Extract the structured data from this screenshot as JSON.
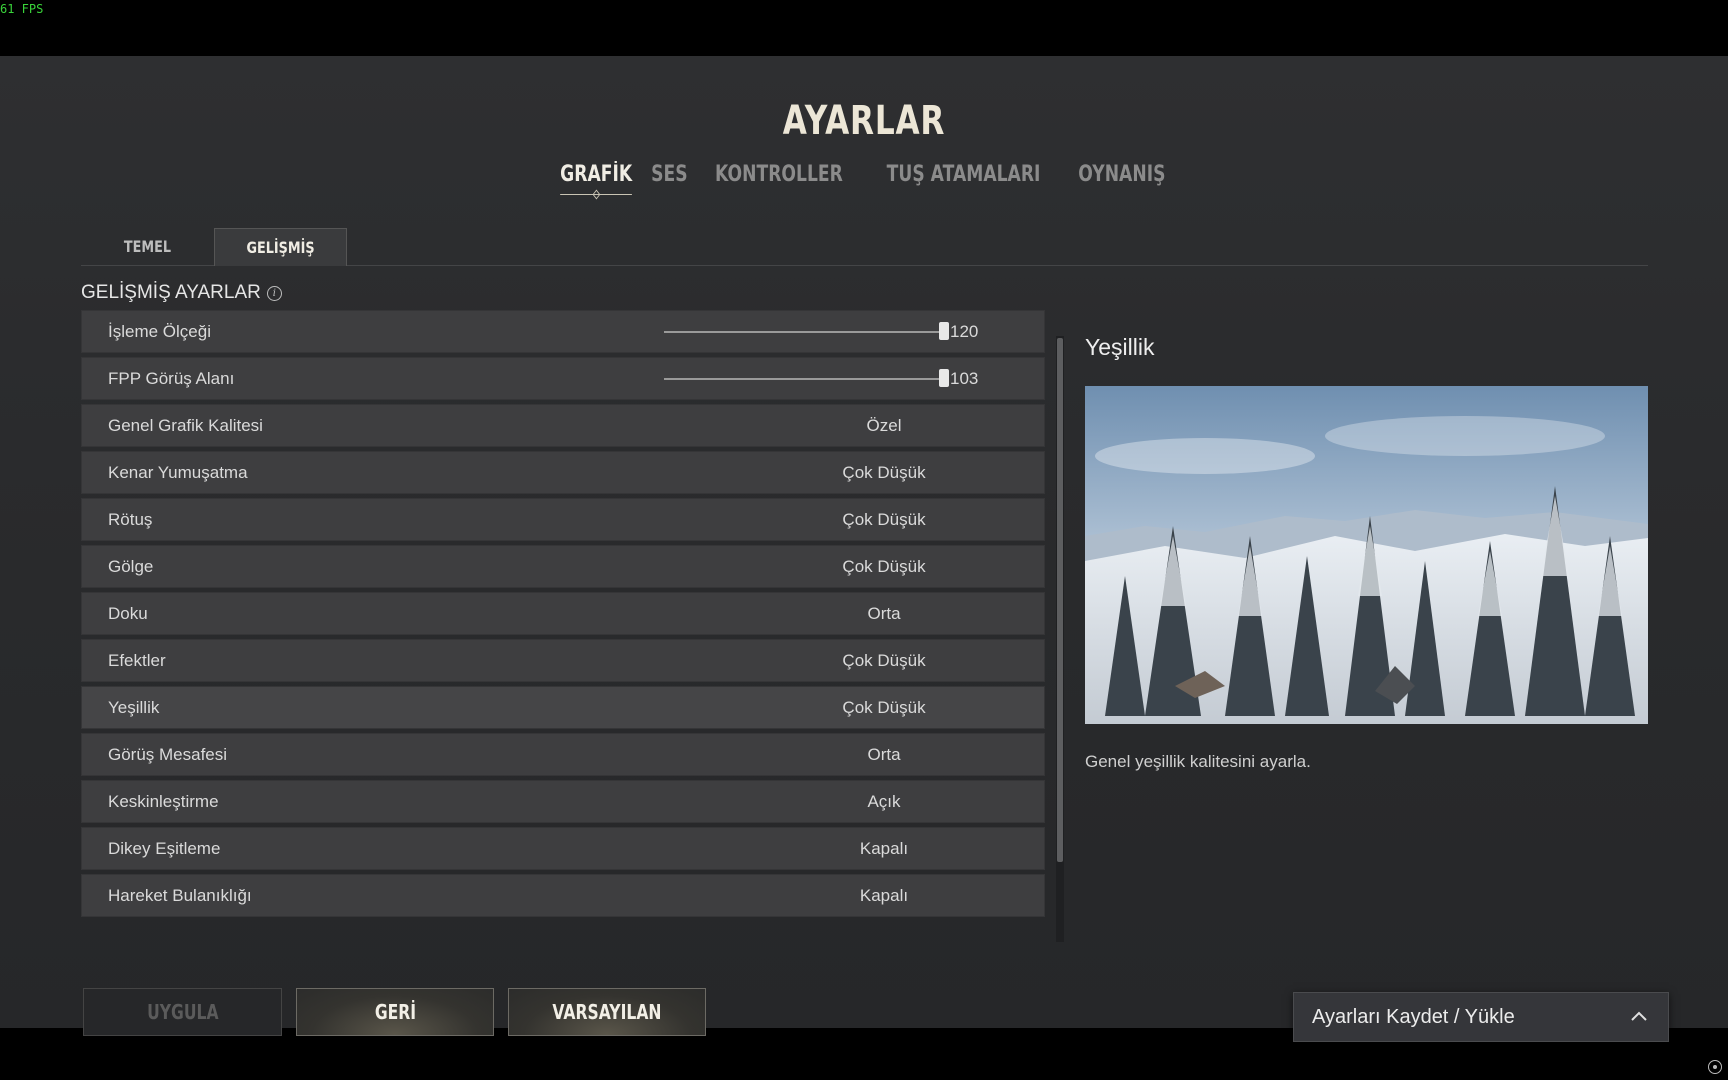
{
  "fps": "61 FPS",
  "title": "AYARLAR",
  "main_tabs": [
    {
      "label": "GRAFİK",
      "active": true
    },
    {
      "label": "SES",
      "active": false
    },
    {
      "label": "KONTROLLER",
      "active": false
    },
    {
      "label": "TUŞ ATAMALARI",
      "active": false
    },
    {
      "label": "OYNANIŞ",
      "active": false
    }
  ],
  "sub_tabs": [
    {
      "label": "TEMEL",
      "active": false
    },
    {
      "label": "GELİŞMİŞ",
      "active": true
    }
  ],
  "section_title": "GELİŞMİŞ AYARLAR",
  "settings": [
    {
      "label": "İşleme Ölçeği",
      "type": "slider",
      "value": "120",
      "fill_fraction": 1.0
    },
    {
      "label": "FPP Görüş Alanı",
      "type": "slider",
      "value": "103",
      "fill_fraction": 1.0
    },
    {
      "label": "Genel Grafik Kalitesi",
      "type": "option",
      "value": "Özel"
    },
    {
      "label": "Kenar Yumuşatma",
      "type": "option",
      "value": "Çok Düşük"
    },
    {
      "label": "Rötuş",
      "type": "option",
      "value": "Çok Düşük"
    },
    {
      "label": "Gölge",
      "type": "option",
      "value": "Çok Düşük"
    },
    {
      "label": "Doku",
      "type": "option",
      "value": "Orta"
    },
    {
      "label": "Efektler",
      "type": "option",
      "value": "Çok Düşük"
    },
    {
      "label": "Yeşillik",
      "type": "option",
      "value": "Çok Düşük",
      "active": true
    },
    {
      "label": "Görüş Mesafesi",
      "type": "option",
      "value": "Orta"
    },
    {
      "label": "Keskinleştirme",
      "type": "option",
      "value": "Açık"
    },
    {
      "label": "Dikey Eşitleme",
      "type": "option",
      "value": "Kapalı"
    },
    {
      "label": "Hareket Bulanıklığı",
      "type": "option",
      "value": "Kapalı"
    }
  ],
  "detail": {
    "title": "Yeşillik",
    "description": "Genel yeşillik kalitesini ayarla."
  },
  "buttons": {
    "apply": "UYGULA",
    "back": "GERİ",
    "defaults": "VARSAYILAN"
  },
  "save_load": "Ayarları Kaydet / Yükle",
  "icons": {
    "info": "info-icon",
    "chevron": "chevron-up-icon",
    "corner": "target-icon"
  }
}
